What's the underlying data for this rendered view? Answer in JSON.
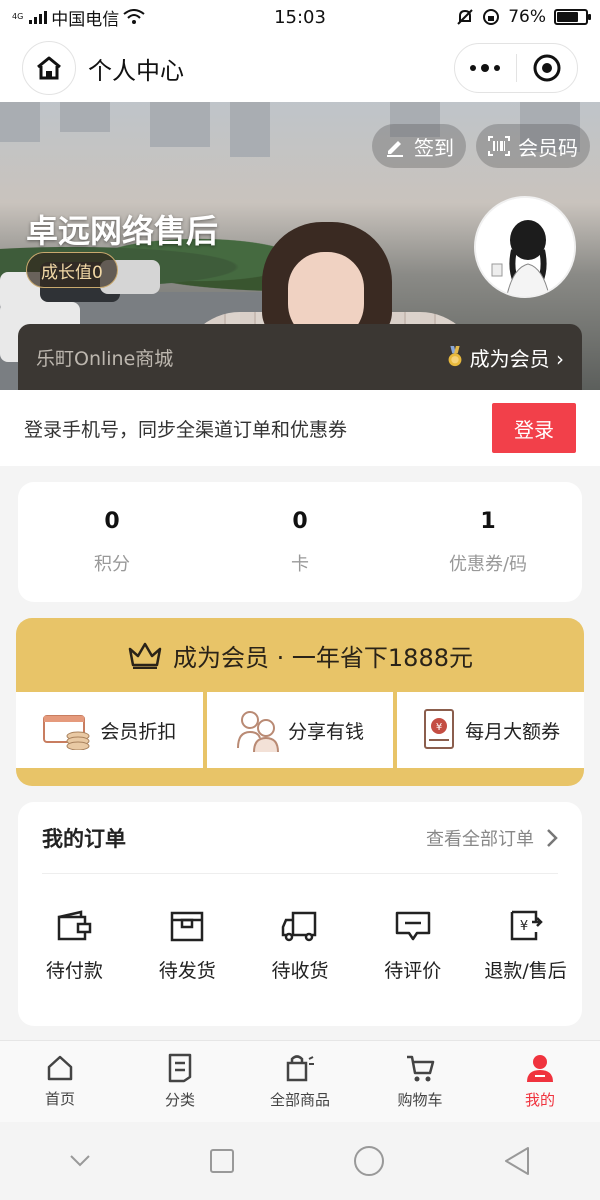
{
  "status_bar": {
    "network_tag": "4G",
    "carrier": "中国电信",
    "time": "15:03",
    "battery_percent": "76%",
    "battery_level": 0.76
  },
  "title_bar": {
    "title": "个人中心"
  },
  "hero": {
    "sign_in_label": "签到",
    "member_code_label": "会员码",
    "store_name": "卓远网络售后",
    "growth_label": "成长值0",
    "mall_name": "乐町Online商城",
    "become_member_label": "成为会员 ›"
  },
  "login": {
    "tip": "登录手机号，同步全渠道订单和优惠券",
    "button_label": "登录"
  },
  "stats": [
    {
      "value": "0",
      "label": "积分"
    },
    {
      "value": "0",
      "label": "卡"
    },
    {
      "value": "1",
      "label": "优惠券/码"
    }
  ],
  "vip": {
    "headline": "成为会员 · 一年省下1888元",
    "benefits": [
      {
        "label": "会员折扣",
        "icon": "discount-icon"
      },
      {
        "label": "分享有钱",
        "icon": "share-people-icon"
      },
      {
        "label": "每月大额券",
        "icon": "coupon-book-icon"
      }
    ]
  },
  "orders": {
    "title": "我的订单",
    "view_all": "查看全部订单",
    "items": [
      {
        "label": "待付款",
        "icon": "wallet-icon"
      },
      {
        "label": "待发货",
        "icon": "box-icon"
      },
      {
        "label": "待收货",
        "icon": "truck-icon"
      },
      {
        "label": "待评价",
        "icon": "comment-icon"
      },
      {
        "label": "退款/售后",
        "icon": "refund-icon"
      }
    ]
  },
  "tab_bar": {
    "tabs": [
      {
        "label": "首页",
        "icon": "home-icon"
      },
      {
        "label": "分类",
        "icon": "list-icon"
      },
      {
        "label": "全部商品",
        "icon": "bag-icon"
      },
      {
        "label": "购物车",
        "icon": "cart-icon"
      },
      {
        "label": "我的",
        "icon": "user-icon",
        "active": true
      }
    ]
  },
  "colors": {
    "accent_red": "#f2404a",
    "vip_gold": "#e8c468",
    "member_bar": "#3b3733"
  }
}
